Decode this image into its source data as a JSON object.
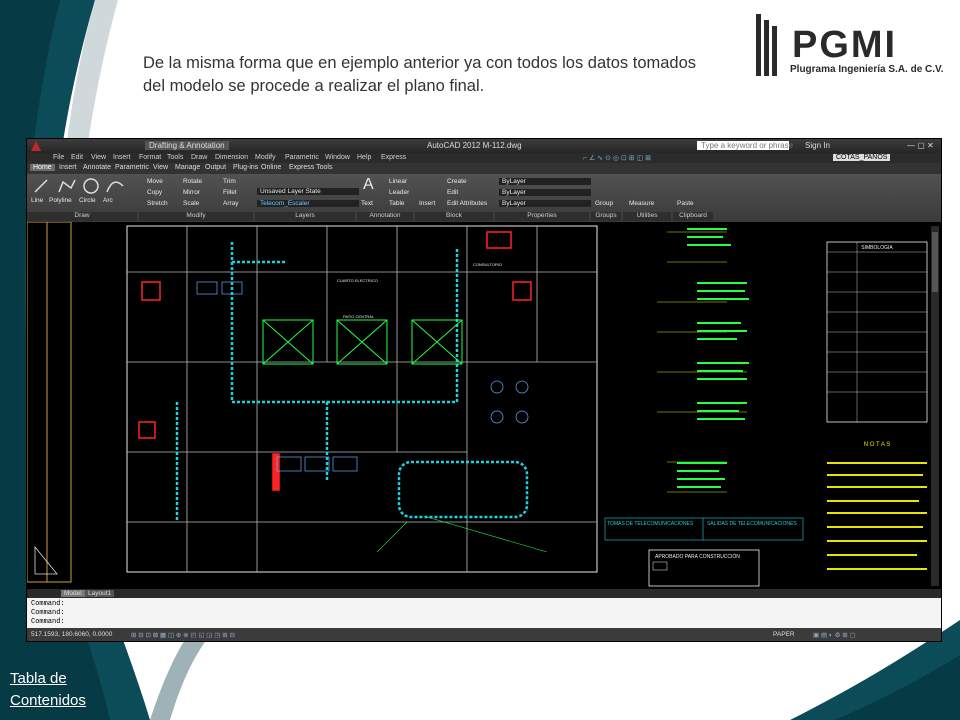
{
  "slide": {
    "caption": "De la misma forma que en ejemplo anterior ya con todos los datos tomados del modelo se procede a realizar el plano final.",
    "toc_link": "Tabla de Contenidos",
    "logo": {
      "name": "PGMI",
      "subtitle": "Plugrama Ingeniería S.A. de C.V."
    },
    "colors": {
      "teal": "#0b4c58",
      "dark_teal": "#063a44",
      "light_band": "#cfd8da",
      "link": "#ffffff"
    }
  },
  "acad": {
    "window_title": "AutoCAD 2012    M-112.dwg",
    "workspace": "Drafting & Annotation",
    "search_placeholder": "Type a keyword or phrase",
    "sign_in": "Sign In",
    "menu": [
      "File",
      "Edit",
      "View",
      "Insert",
      "Format",
      "Tools",
      "Draw",
      "Dimension",
      "Modify",
      "Parametric",
      "Window",
      "Help",
      "Express"
    ],
    "tabs": [
      "Home",
      "Insert",
      "Annotate",
      "Parametric",
      "View",
      "Manage",
      "Output",
      "Plug-ins",
      "Online",
      "Express Tools"
    ],
    "active_tab": "Home",
    "draw_tools": [
      "Line",
      "Polyline",
      "Circle",
      "Arc"
    ],
    "modify_tools": [
      [
        "Move",
        "Rotate",
        "Trim"
      ],
      [
        "Copy",
        "Mirror",
        "Fillet"
      ],
      [
        "Stretch",
        "Scale",
        "Array"
      ]
    ],
    "layer_state": "Unsaved Layer State",
    "current_layer": "Telecom_Escaler",
    "annotation_tools": [
      "Text",
      "Linear",
      "Leader",
      "Table"
    ],
    "block_tools": [
      "Insert",
      "Create",
      "Edit",
      "Edit Attributes"
    ],
    "property_values": [
      "ByLayer",
      "ByLayer",
      "ByLayer"
    ],
    "utilities": [
      "Group",
      "Measure",
      "Paste"
    ],
    "dimstyle": "COTAS_PAÑOS",
    "panels": [
      "Draw",
      "Modify",
      "Layers",
      "Annotation",
      "Block",
      "Properties",
      "Groups",
      "Utilities",
      "Clipboard"
    ],
    "layout_tabs": [
      "Model",
      "Layout1"
    ],
    "command_lines": [
      "Command:",
      "Command:",
      "Command:"
    ],
    "coordinates": "517.1593, 180.6060, 0.0000",
    "paper_label": "PAPER",
    "drawing": {
      "symbology_title": "SIMBOLOGIA",
      "notes_title": "N O T A S",
      "stamp_title": "APROBADO PARA CONSTRUCCIÓN",
      "table_title_left": "TOMAS DE TELECOMUNICACIONES",
      "table_title_right": "SALIDAS DE TELECOMUNICACIONES",
      "room_labels": [
        "CUARTO ELECTRICO",
        "PATIO CENTRAL",
        "CONSULTORIO"
      ]
    }
  }
}
